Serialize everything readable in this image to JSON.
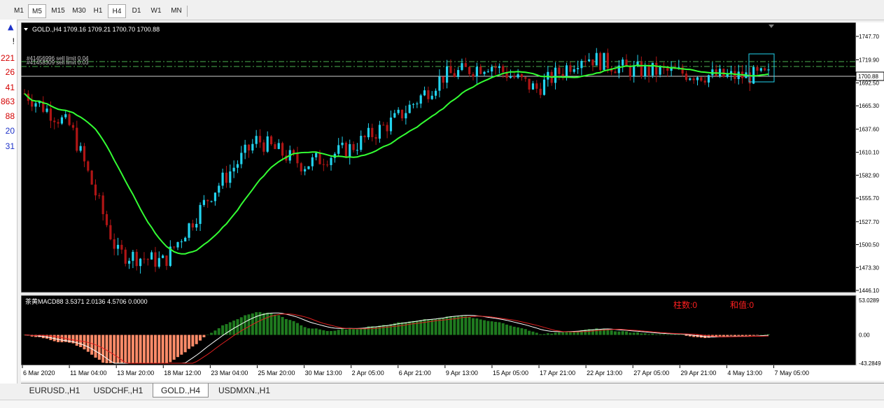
{
  "timeframes": [
    "M1",
    "M5",
    "M15",
    "M30",
    "H1",
    "H4",
    "D1",
    "W1",
    "MN"
  ],
  "active_timeframe": "H4",
  "left_values": [
    {
      "text": "!",
      "color": "#000000"
    },
    {
      "text": "221",
      "color": "#d40000"
    },
    {
      "text": "26",
      "color": "#d40000"
    },
    {
      "text": "41",
      "color": "#d40000"
    },
    {
      "text": "863",
      "color": "#d40000"
    },
    {
      "text": "88",
      "color": "#d40000"
    },
    {
      "text": "20",
      "color": "#1e32c8"
    },
    {
      "text": "31",
      "color": "#1e32c8"
    }
  ],
  "chart": {
    "header": "GOLD.,H4  1709.16 1709.21 1700.70 1700.88",
    "orders": [
      "#41456996 sell limit 0.04",
      "#41458309 sell limit 0.03"
    ],
    "current_price": "1700.88",
    "y_ticks": [
      "1747.70",
      "1719.90",
      "1692.50",
      "1665.30",
      "1637.60",
      "1610.10",
      "1582.90",
      "1555.70",
      "1527.70",
      "1500.50",
      "1473.30",
      "1446.10"
    ],
    "x_ticks": [
      "6 Mar 2020",
      "11 Mar 04:00",
      "13 Mar 20:00",
      "18 Mar 12:00",
      "23 Mar 04:00",
      "25 Mar 20:00",
      "30 Mar 13:00",
      "2 Apr 05:00",
      "6 Apr 21:00",
      "9 Apr 13:00",
      "15 Apr 05:00",
      "17 Apr 21:00",
      "22 Apr 13:00",
      "27 Apr 05:00",
      "29 Apr 21:00",
      "4 May 13:00",
      "7 May 05:00"
    ],
    "colors": {
      "bg": "#000000",
      "up": "#22d3ee",
      "down": "#b01515",
      "ma": "#33ff33",
      "order_line": "#4caf50",
      "grid": "#ffffff"
    }
  },
  "chart_data": {
    "type": "candlestick",
    "symbol": "GOLD.",
    "timeframe": "H4",
    "ohlc_last": {
      "open": 1709.16,
      "high": 1709.21,
      "low": 1700.7,
      "close": 1700.88
    },
    "ylim": [
      1446.1,
      1747.7
    ],
    "approx_close_path": [
      {
        "x": "6 Mar 2020",
        "close": 1680
      },
      {
        "x": "11 Mar 04:00",
        "close": 1640
      },
      {
        "x": "13 Mar 20:00",
        "close": 1490
      },
      {
        "x": "18 Mar 12:00",
        "close": 1480
      },
      {
        "x": "23 Mar 04:00",
        "close": 1560
      },
      {
        "x": "25 Mar 20:00",
        "close": 1625
      },
      {
        "x": "30 Mar 13:00",
        "close": 1595
      },
      {
        "x": "2 Apr 05:00",
        "close": 1615
      },
      {
        "x": "6 Apr 21:00",
        "close": 1650
      },
      {
        "x": "9 Apr 13:00",
        "close": 1700
      },
      {
        "x": "15 Apr 05:00",
        "close": 1715
      },
      {
        "x": "17 Apr 21:00",
        "close": 1685
      },
      {
        "x": "22 Apr 13:00",
        "close": 1725
      },
      {
        "x": "27 Apr 05:00",
        "close": 1708
      },
      {
        "x": "29 Apr 21:00",
        "close": 1705
      },
      {
        "x": "4 May 13:00",
        "close": 1700
      },
      {
        "x": "7 May 05:00",
        "close": 1700.88
      }
    ]
  },
  "macd": {
    "label": "茶黄MACD88 3.5371 2.0136 4.5706 0.0000",
    "annotation_bars": "柱数:0",
    "annotation_sum": "和值:0",
    "y_ticks": [
      "53.0289",
      "0.00",
      "-43.2849"
    ],
    "colors": {
      "pos": "#1f7a1f",
      "neg": "#ff8c69",
      "line1": "#ffffff",
      "line2": "#e02020",
      "annotation": "#ff2020"
    }
  },
  "tabs": [
    "EURUSD.,H1",
    "USDCHF.,H1",
    "GOLD.,H4",
    "USDMXN.,H1"
  ],
  "active_tab": "GOLD.,H4"
}
